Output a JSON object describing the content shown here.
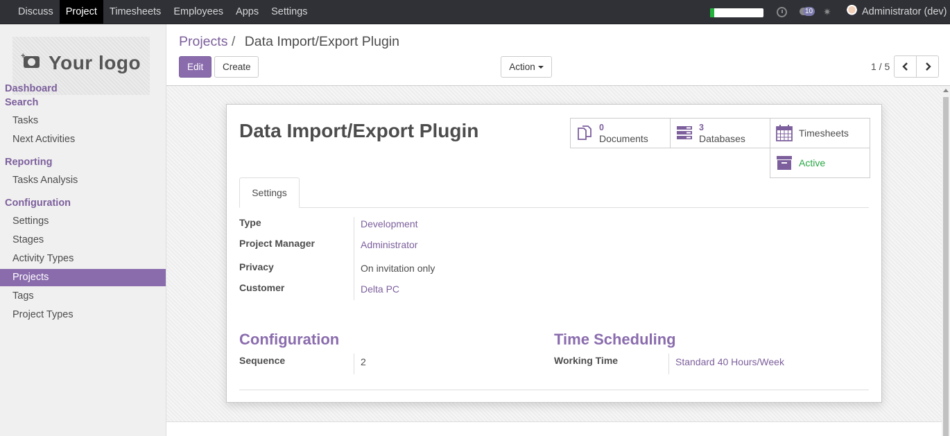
{
  "topbar": {
    "menu": [
      "Discuss",
      "Project",
      "Timesheets",
      "Employees",
      "Apps",
      "Settings"
    ],
    "active_menu": "Project",
    "progress_fraction": 0.08,
    "message_count": "10",
    "user_name": "Administrator (dev)"
  },
  "sidebar": {
    "logo_text": "Your logo",
    "dashboard": "Dashboard",
    "search": "Search",
    "search_items": [
      "Tasks",
      "Next Activities"
    ],
    "reporting": "Reporting",
    "reporting_items": [
      "Tasks Analysis"
    ],
    "configuration": "Configuration",
    "configuration_items": [
      "Settings",
      "Stages",
      "Activity Types",
      "Projects",
      "Tags",
      "Project Types"
    ],
    "active_item": "Projects"
  },
  "control_panel": {
    "breadcrumb_parent": "Projects",
    "breadcrumb_sep": "/",
    "breadcrumb_current": "Data Import/Export Plugin",
    "edit_label": "Edit",
    "create_label": "Create",
    "action_label": "Action",
    "pager": "1 / 5"
  },
  "form": {
    "title": "Data Import/Export Plugin",
    "buttons": {
      "documents": {
        "count": "0",
        "label": "Documents"
      },
      "databases": {
        "count": "3",
        "label": "Databases"
      },
      "timesheets": {
        "label": "Timesheets"
      },
      "active": {
        "label": "Active"
      }
    },
    "tab": "Settings",
    "fields": {
      "type": {
        "label": "Type",
        "value": "Development"
      },
      "manager": {
        "label": "Project Manager",
        "value": "Administrator"
      },
      "privacy": {
        "label": "Privacy",
        "value": "On invitation only"
      },
      "customer": {
        "label": "Customer",
        "value": "Delta PC"
      }
    },
    "configuration": {
      "title": "Configuration",
      "sequence_label": "Sequence",
      "sequence_value": "2"
    },
    "scheduling": {
      "title": "Time Scheduling",
      "working_time_label": "Working Time",
      "working_time_value": "Standard 40 Hours/Week"
    }
  },
  "colors": {
    "brand": "#8a6cad",
    "link": "#7c5f9c",
    "active_green": "#28a745",
    "navbar": "#2f3136"
  }
}
